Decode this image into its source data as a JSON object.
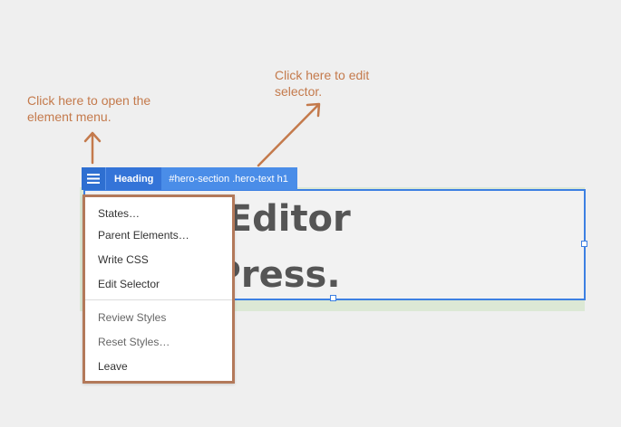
{
  "annotations": {
    "menu_hint": "Click here to open the\nelement menu.",
    "selector_hint": "Click here to edit\nselector."
  },
  "toolbar": {
    "element_label": "Heading",
    "selector": "#hero-section .hero-text h1",
    "menu_icon": "hamburger-icon"
  },
  "hero": {
    "line1": "Style Editor",
    "line2": "WordPress."
  },
  "element_menu": {
    "items_group1": [
      "States…",
      "Parent Elements…",
      "Write CSS",
      "Edit Selector"
    ],
    "items_group2": [
      "Review Styles",
      "Reset Styles…",
      "Leave"
    ]
  },
  "colors": {
    "accent": "#3d80e2",
    "annotation": "#c47a4c",
    "menu_border": "#b3795a"
  }
}
